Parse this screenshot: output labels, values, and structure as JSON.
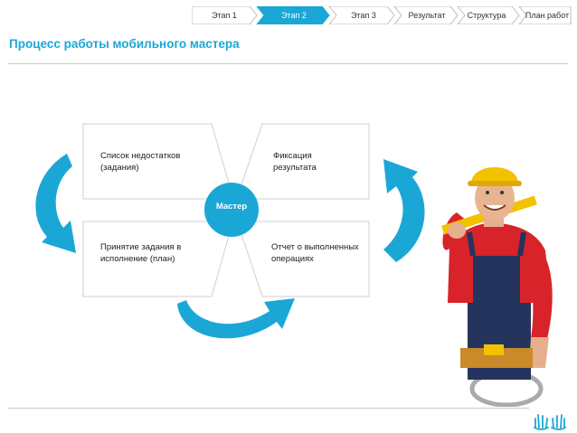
{
  "nav": {
    "steps": [
      {
        "label": "Этап 1",
        "active": false
      },
      {
        "label": "Этап 2",
        "active": true
      },
      {
        "label": "Этап 3",
        "active": false
      },
      {
        "label": "Результат",
        "active": false
      },
      {
        "label": "Структура",
        "active": false
      },
      {
        "label": "План работ",
        "active": false
      }
    ],
    "active_color": "#1ba7d6",
    "inactive_color": "#ffffff"
  },
  "header": {
    "title": "Процесс работы мобильного мастера"
  },
  "diagram": {
    "center": "Мастер",
    "boxes": {
      "top_left": "Список недостатков (задания)",
      "top_right": "Фиксация результата",
      "bottom_left": "Принятие задания в исполнение (план)",
      "bottom_right": "Отчет о выполненных операциях"
    },
    "cycle_arrows": [
      "arrow-left-down",
      "arrow-bottom-right",
      "arrow-right-up"
    ],
    "accent_color": "#1ba7d6"
  },
  "illustration": {
    "subject": "worker-in-hard-hat",
    "hardhat_color": "#f2c200",
    "shirt_color": "#d8232a",
    "overalls_color": "#24345c"
  },
  "brand": {
    "logo_icon": "hands-logo-icon"
  }
}
